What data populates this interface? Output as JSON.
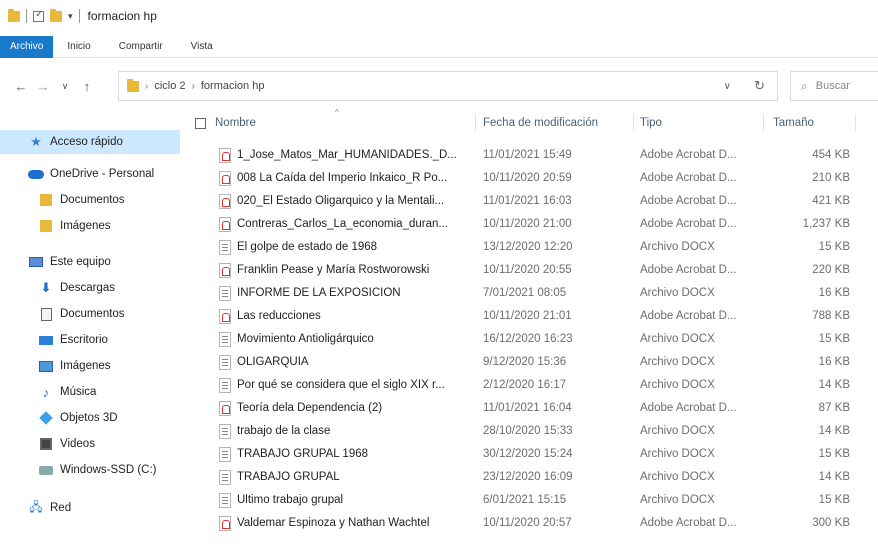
{
  "window": {
    "title": "formacion hp"
  },
  "ribbon": {
    "tabs": [
      {
        "label": "Archivo"
      },
      {
        "label": "Inicio"
      },
      {
        "label": "Compartir"
      },
      {
        "label": "Vista"
      }
    ]
  },
  "address": {
    "crumbs": [
      "ciclo 2",
      "formacion hp"
    ],
    "search_placeholder": "Buscar"
  },
  "sidebar": {
    "items": [
      {
        "label": "Acceso rápido",
        "icon": "star-icon",
        "selected": true
      },
      {
        "label": "OneDrive - Personal",
        "icon": "cloud-icon"
      },
      {
        "label": "Documentos",
        "icon": "folder-icon"
      },
      {
        "label": "Imágenes",
        "icon": "folder-icon"
      },
      {
        "label": "Este equipo",
        "icon": "computer-icon"
      },
      {
        "label": "Descargas",
        "icon": "download-icon"
      },
      {
        "label": "Documentos",
        "icon": "document-icon"
      },
      {
        "label": "Escritorio",
        "icon": "desktop-icon"
      },
      {
        "label": "Imágenes",
        "icon": "pictures-icon"
      },
      {
        "label": "Música",
        "icon": "music-icon"
      },
      {
        "label": "Objetos 3D",
        "icon": "cube-icon"
      },
      {
        "label": "Videos",
        "icon": "video-icon"
      },
      {
        "label": "Windows-SSD (C:)",
        "icon": "drive-icon"
      },
      {
        "label": "Red",
        "icon": "network-icon"
      }
    ]
  },
  "columns": {
    "name": "Nombre",
    "date": "Fecha de modificación",
    "type": "Tipo",
    "size": "Tamaño"
  },
  "files": [
    {
      "name": "1_Jose_Matos_Mar_HUMANIDADES._D...",
      "date": "11/01/2021 15:49",
      "type": "Adobe Acrobat D...",
      "size": "454 KB",
      "kind": "pdf"
    },
    {
      "name": "008 La Caída del Imperio Inkaico_R Po...",
      "date": "10/11/2020 20:59",
      "type": "Adobe Acrobat D...",
      "size": "210 KB",
      "kind": "pdf"
    },
    {
      "name": "020_El Estado Oligarquico y la Mentali...",
      "date": "11/01/2021 16:03",
      "type": "Adobe Acrobat D...",
      "size": "421 KB",
      "kind": "pdf"
    },
    {
      "name": "Contreras_Carlos_La_economia_duran...",
      "date": "10/11/2020 21:00",
      "type": "Adobe Acrobat D...",
      "size": "1,237 KB",
      "kind": "pdf"
    },
    {
      "name": "El golpe de estado de 1968",
      "date": "13/12/2020 12:20",
      "type": "Archivo DOCX",
      "size": "15 KB",
      "kind": "docx"
    },
    {
      "name": "Franklin Pease y María Rostworowski",
      "date": "10/11/2020 20:55",
      "type": "Adobe Acrobat D...",
      "size": "220 KB",
      "kind": "pdf"
    },
    {
      "name": "INFORME DE LA EXPOSICIÓN",
      "date": "7/01/2021 08:05",
      "type": "Archivo DOCX",
      "size": "16 KB",
      "kind": "docx"
    },
    {
      "name": "Las reducciones",
      "date": "10/11/2020 21:01",
      "type": "Adobe Acrobat D...",
      "size": "788 KB",
      "kind": "pdf"
    },
    {
      "name": "Movimiento Antioligárquico",
      "date": "16/12/2020 16:23",
      "type": "Archivo DOCX",
      "size": "15 KB",
      "kind": "docx"
    },
    {
      "name": "OLIGARQUÍA",
      "date": "9/12/2020 15:36",
      "type": "Archivo DOCX",
      "size": "16 KB",
      "kind": "docx"
    },
    {
      "name": "Por qué se considera que el siglo XIX r...",
      "date": "2/12/2020 16:17",
      "type": "Archivo DOCX",
      "size": "14 KB",
      "kind": "docx"
    },
    {
      "name": "Teoría dela Dependencia (2)",
      "date": "11/01/2021 16:04",
      "type": "Adobe Acrobat D...",
      "size": "87 KB",
      "kind": "pdf"
    },
    {
      "name": "trabajo de la clase",
      "date": "28/10/2020 15:33",
      "type": "Archivo DOCX",
      "size": "14 KB",
      "kind": "docx"
    },
    {
      "name": "TRABAJO GRUPAL 1968",
      "date": "30/12/2020 15:24",
      "type": "Archivo DOCX",
      "size": "15 KB",
      "kind": "docx"
    },
    {
      "name": "TRABAJO GRUPAL",
      "date": "23/12/2020 16:09",
      "type": "Archivo DOCX",
      "size": "14 KB",
      "kind": "docx"
    },
    {
      "name": "Último trabajo grupal",
      "date": "6/01/2021 15:15",
      "type": "Archivo DOCX",
      "size": "15 KB",
      "kind": "docx"
    },
    {
      "name": "Valdemar Espinoza y Nathan Wachtel",
      "date": "10/11/2020 20:57",
      "type": "Adobe Acrobat D...",
      "size": "300 KB",
      "kind": "pdf"
    }
  ]
}
